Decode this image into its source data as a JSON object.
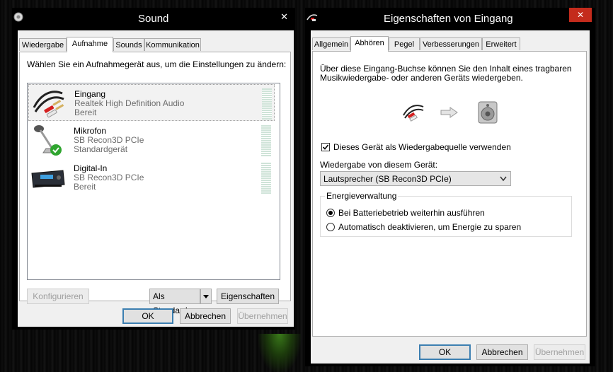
{
  "sound": {
    "title": "Sound",
    "close": "✕",
    "tabs": [
      {
        "label": "Wiedergabe"
      },
      {
        "label": "Aufnahme"
      },
      {
        "label": "Sounds"
      },
      {
        "label": "Kommunikation"
      }
    ],
    "instruction": "Wählen Sie ein Aufnahmegerät aus, um die Einstellungen zu ändern:",
    "devices": [
      {
        "name": "Eingang",
        "driver": "Realtek High Definition Audio",
        "status": "Bereit",
        "icon": "audio-cable-icon"
      },
      {
        "name": "Mikrofon",
        "driver": "SB Recon3D PCIe",
        "status": "Standardgerät",
        "icon": "microphone-icon"
      },
      {
        "name": "Digital-In",
        "driver": "SB Recon3D PCIe",
        "status": "Bereit",
        "icon": "digital-receiver-icon"
      }
    ],
    "configure": "Konfigurieren",
    "set_default": "Als Standard",
    "properties": "Eigenschaften",
    "ok": "OK",
    "cancel": "Abbrechen",
    "apply": "Übernehmen"
  },
  "props": {
    "title": "Eigenschaften von Eingang",
    "close": "✕",
    "tabs": [
      {
        "label": "Allgemein"
      },
      {
        "label": "Abhören"
      },
      {
        "label": "Pegel"
      },
      {
        "label": "Verbesserungen"
      },
      {
        "label": "Erweitert"
      }
    ],
    "description": "Über diese Eingang-Buchse können Sie den Inhalt eines tragbaren Musikwiedergabe- oder anderen Geräts wiedergeben.",
    "listen_checkbox": "Dieses Gerät als Wiedergabequelle verwenden",
    "listen_checked": true,
    "playback_label": "Wiedergabe von diesem Gerät:",
    "playback_device": "Lautsprecher (SB Recon3D PCIe)",
    "power_group": "Energieverwaltung",
    "power_options": [
      {
        "label": "Bei Batteriebetrieb weiterhin ausführen",
        "selected": true
      },
      {
        "label": "Automatisch deaktivieren, um Energie zu sparen",
        "selected": false
      }
    ],
    "ok": "OK",
    "cancel": "Abbrechen",
    "apply": "Übernehmen"
  }
}
